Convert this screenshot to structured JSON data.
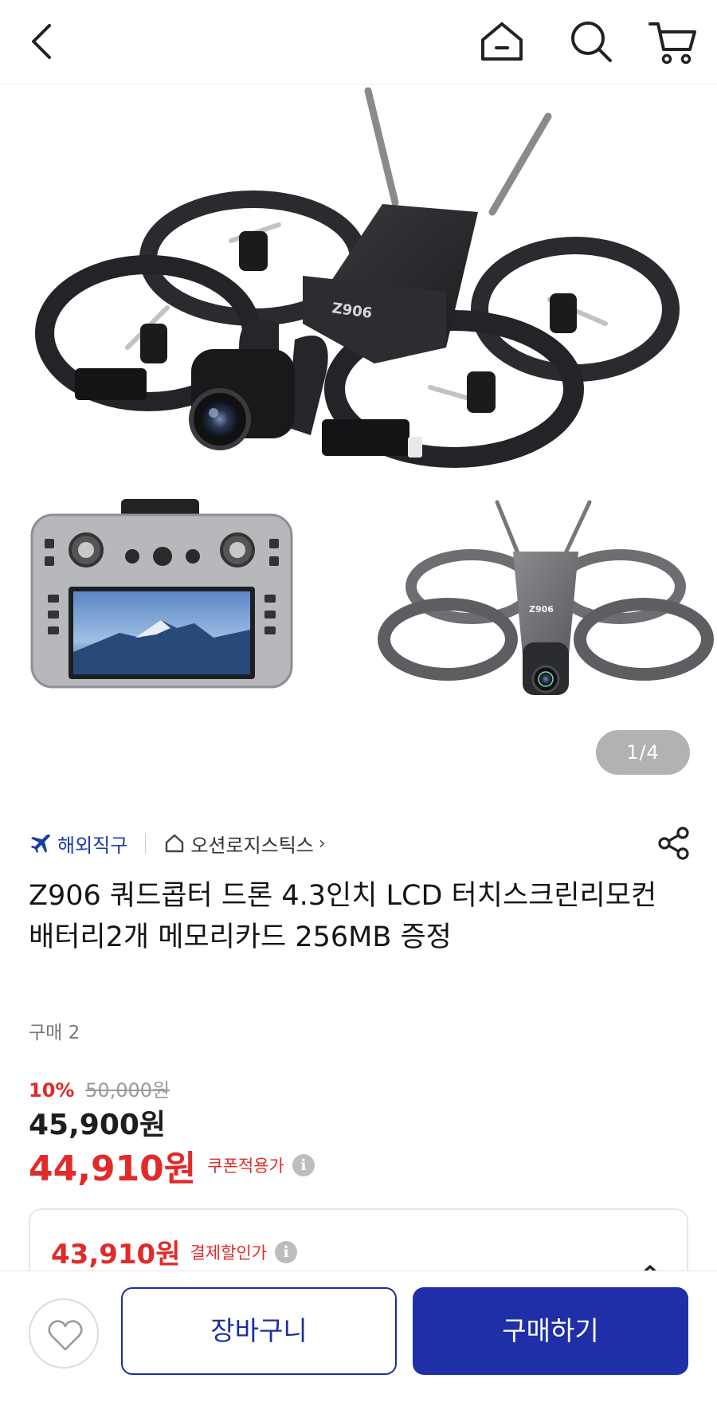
{
  "nav": {
    "back_icon": "chevron-left-icon",
    "home_icon": "home-icon",
    "search_icon": "search-icon",
    "cart_icon": "cart-icon"
  },
  "gallery": {
    "page_indicator": "1/4",
    "drone_brand_mark": "Z906"
  },
  "seller": {
    "overseas_label": "해외직구",
    "store_name": "오션로지스틱스",
    "store_chevron": "›"
  },
  "product": {
    "title": "Z906 쿼드콥터 드론 4.3인치 LCD 터치스크린리모컨 배터리2개 메모리카드 256MB 증정",
    "purchase_count": "구매 2"
  },
  "price": {
    "discount_rate": "10%",
    "original_price": "50,000원",
    "sale_price": "45,900원",
    "coupon_price": "44,910원",
    "coupon_label": "쿠폰적용가",
    "payment_price": "43,910원",
    "payment_label": "결제할인가",
    "info_glyph": "i"
  },
  "bottom": {
    "cart_button": "장바구니",
    "buy_button": "구매하기"
  },
  "colors": {
    "accent_blue": "#1f2fa8",
    "price_red": "#e22a2a"
  }
}
